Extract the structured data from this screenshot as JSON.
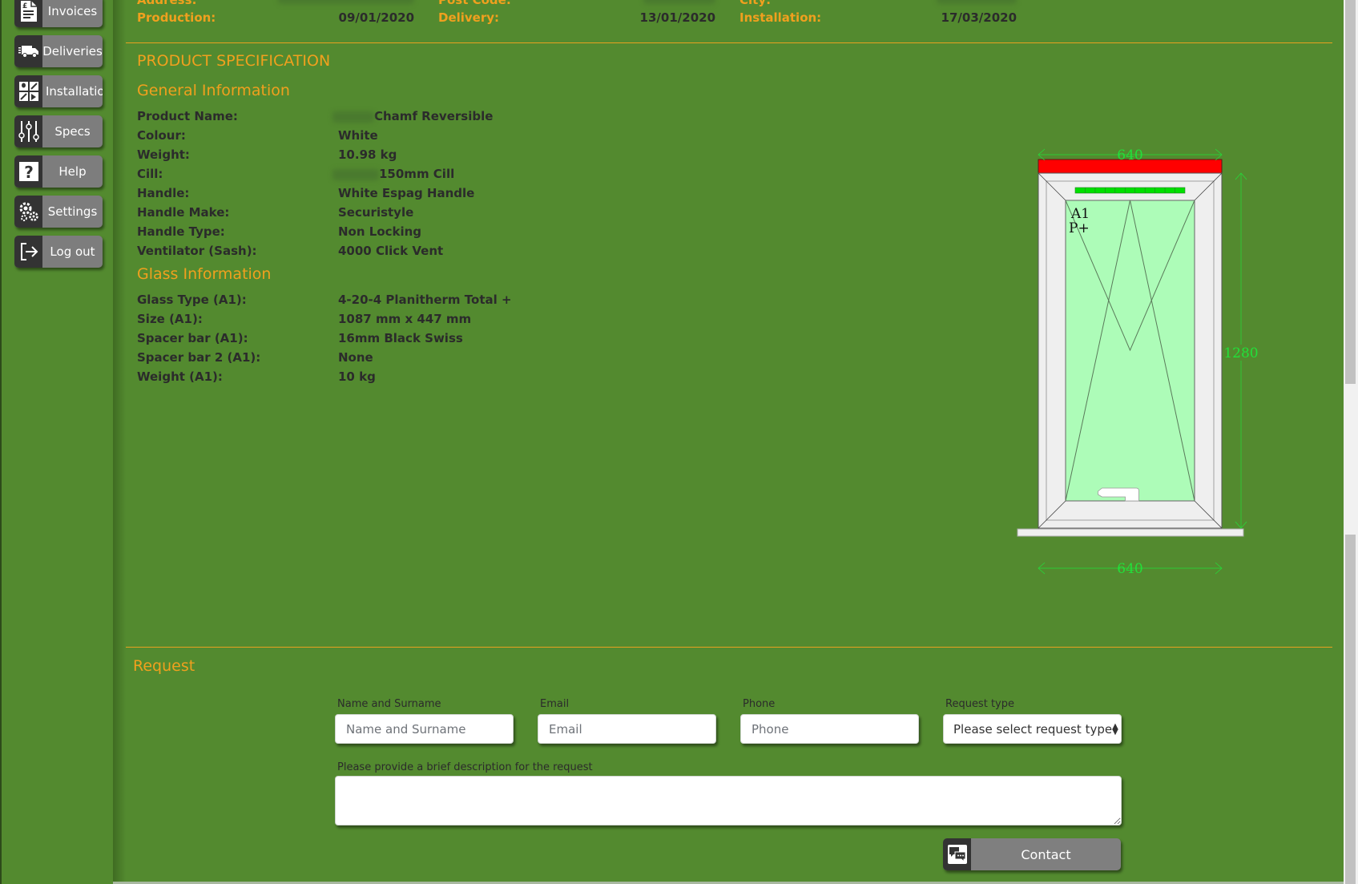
{
  "sidebar": {
    "items": [
      {
        "label": "Invoices",
        "icon": "invoice-icon"
      },
      {
        "label": "Deliveries",
        "icon": "truck-icon"
      },
      {
        "label": "Installations",
        "icon": "installations-icon"
      },
      {
        "label": "Specs",
        "icon": "sliders-icon"
      },
      {
        "label": "Help",
        "icon": "question-icon"
      },
      {
        "label": "Settings",
        "icon": "gears-icon"
      },
      {
        "label": "Log out",
        "icon": "logout-icon"
      }
    ]
  },
  "order_info": {
    "row1": [
      {
        "label": "Address:",
        "value": ""
      },
      {
        "label": "Post Code:",
        "value": ""
      },
      {
        "label": "City:",
        "value": ""
      }
    ],
    "row2": [
      {
        "label": "Production:",
        "value": "09/01/2020"
      },
      {
        "label": "Delivery:",
        "value": "13/01/2020"
      },
      {
        "label": "Installation:",
        "value": "17/03/2020"
      }
    ]
  },
  "spec": {
    "title": "PRODUCT SPECIFICATION",
    "general": {
      "title": "General Information",
      "rows": [
        {
          "label": "Product Name:",
          "value": "Chamf Reversible"
        },
        {
          "label": "Colour:",
          "value": "White"
        },
        {
          "label": "Weight:",
          "value": "10.98 kg"
        },
        {
          "label": "Cill:",
          "value": "150mm Cill"
        },
        {
          "label": "Handle:",
          "value": "White Espag Handle"
        },
        {
          "label": "Handle Make:",
          "value": "Securistyle"
        },
        {
          "label": "Handle Type:",
          "value": "Non Locking"
        },
        {
          "label": "Ventilator (Sash):",
          "value": "4000 Click Vent"
        }
      ]
    },
    "glass": {
      "title": "Glass Information",
      "rows": [
        {
          "label": "Glass Type (A1):",
          "value": "4-20-4 Planitherm Total +"
        },
        {
          "label": "Size (A1):",
          "value": "1087 mm x 447 mm"
        },
        {
          "label": "Spacer bar (A1):",
          "value": "16mm Black Swiss"
        },
        {
          "label": "Spacer bar 2 (A1):",
          "value": "None"
        },
        {
          "label": "Weight (A1):",
          "value": "10 kg"
        }
      ]
    }
  },
  "drawing": {
    "width_top": "640",
    "width_bottom": "640",
    "height": "1280",
    "pane_label": "A1",
    "pane_sub": "P+",
    "colors": {
      "head_bar": "#ff0000",
      "frame": "#efefef",
      "glass": "#adfcb8",
      "vent": "#00e000",
      "dimension": "#22e03a"
    }
  },
  "request": {
    "title": "Request",
    "name_label": "Name and Surname",
    "name_placeholder": "Name and Surname",
    "email_label": "Email",
    "email_placeholder": "Email",
    "phone_label": "Phone",
    "phone_placeholder": "Phone",
    "type_label": "Request type",
    "type_selected": "Please select request type",
    "description_label": "Please provide a brief description for the request",
    "description_value": "",
    "contact_label": "Contact"
  },
  "colors": {
    "background": "#538a2f",
    "accent": "#f0a01e",
    "button": "#7d7d7d",
    "icon_bg": "#333333"
  }
}
